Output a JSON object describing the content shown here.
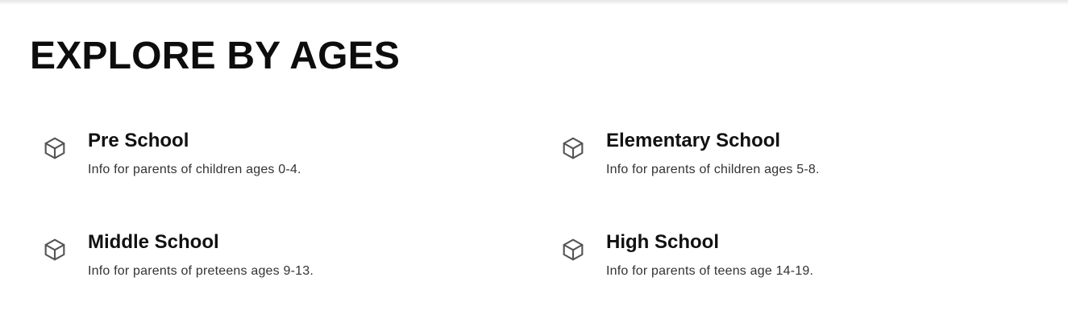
{
  "section": {
    "title": "EXPLORE BY AGES"
  },
  "colors": {
    "text": "#111111",
    "muted_text": "#333333",
    "icon": "#555555",
    "background": "#ffffff"
  },
  "cards": [
    {
      "icon": "cube-icon",
      "heading": "Pre School",
      "description": "Info for parents of children ages 0-4."
    },
    {
      "icon": "cube-icon",
      "heading": "Elementary School",
      "description": "Info for parents of children ages 5-8."
    },
    {
      "icon": "cube-icon",
      "heading": "Middle School",
      "description": "Info for parents of preteens ages 9-13."
    },
    {
      "icon": "cube-icon",
      "heading": "High School",
      "description": "Info for parents of teens age 14-19."
    }
  ]
}
